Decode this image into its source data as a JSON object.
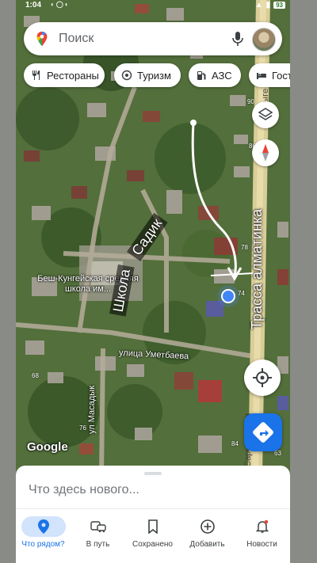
{
  "status_bar": {
    "time": "1:04",
    "battery": "93"
  },
  "search": {
    "placeholder": "Поиск"
  },
  "chips": [
    {
      "label": "Рестораны",
      "icon": "restaurant-icon"
    },
    {
      "label": "Туризм",
      "icon": "camera-icon"
    },
    {
      "label": "АЗС",
      "icon": "gas-station-icon"
    },
    {
      "label": "Гости",
      "icon": "bed-icon"
    }
  ],
  "map": {
    "place_label": "Беш-Кунгейская средняя школа им...",
    "street_labels": [
      "улица Уметбаева",
      "ул Масадык",
      "Сарыге",
      "Сарыгебаева"
    ],
    "house_numbers": [
      "90",
      "86",
      "78",
      "74",
      "76",
      "84",
      "68",
      "63"
    ],
    "handwritten": [
      "Школа",
      "Садик",
      "Трасса алматинка"
    ],
    "attribution": "Google"
  },
  "bottom_sheet": {
    "prompt": "Что здесь нового..."
  },
  "nav": [
    {
      "label": "Что рядом?",
      "icon": "location-pin-icon",
      "active": true
    },
    {
      "label": "В путь",
      "icon": "bus-car-icon",
      "active": false
    },
    {
      "label": "Сохранено",
      "icon": "bookmark-icon",
      "active": false
    },
    {
      "label": "Добавить",
      "icon": "add-circle-icon",
      "active": false
    },
    {
      "label": "Новости",
      "icon": "bell-icon",
      "active": false
    }
  ],
  "colors": {
    "accent": "#1a73e8",
    "map_green": "#3f5a2e"
  }
}
